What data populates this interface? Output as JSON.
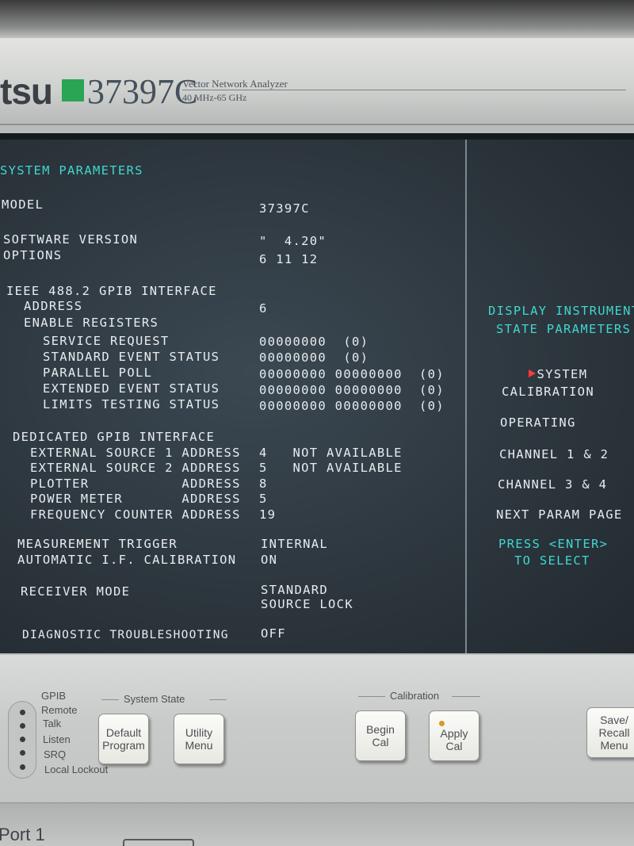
{
  "bezel": {
    "brand_fragment": "tsu",
    "model_number": "37397C",
    "product_name": "Vector Network Analyzer",
    "frequency_range": "40 MHz-65 GHz"
  },
  "screen": {
    "title": "SYSTEM PARAMETERS",
    "model_label": "MODEL",
    "model_value": "37397C",
    "software_version_label": "SOFTWARE VERSION",
    "software_version_value": "\"  4.20\"",
    "options_label": "OPTIONS",
    "options_value": "6 11 12",
    "ieee_label": "IEEE 488.2 GPIB INTERFACE",
    "address_label": "ADDRESS",
    "address_value": "6",
    "enable_registers_label": "ENABLE REGISTERS",
    "registers": [
      {
        "label": "SERVICE REQUEST",
        "value": "00000000  (0)"
      },
      {
        "label": "STANDARD EVENT STATUS",
        "value": "00000000  (0)"
      },
      {
        "label": "PARALLEL POLL",
        "value": "00000000 00000000  (0)"
      },
      {
        "label": "EXTENDED EVENT STATUS",
        "value": "00000000 00000000  (0)"
      },
      {
        "label": "LIMITS TESTING STATUS",
        "value": "00000000 00000000  (0)"
      }
    ],
    "dedicated_label": "DEDICATED GPIB INTERFACE",
    "dedicated": [
      {
        "label": "EXTERNAL SOURCE 1 ADDRESS",
        "value": "4   NOT AVAILABLE"
      },
      {
        "label": "EXTERNAL SOURCE 2 ADDRESS",
        "value": "5   NOT AVAILABLE"
      },
      {
        "label": "PLOTTER           ADDRESS",
        "value": "8"
      },
      {
        "label": "POWER METER       ADDRESS",
        "value": "5"
      },
      {
        "label": "FREQUENCY COUNTER ADDRESS",
        "value": "19"
      }
    ],
    "measurement_trigger_label": "MEASUREMENT TRIGGER",
    "measurement_trigger_value": "INTERNAL",
    "auto_if_cal_label": "AUTOMATIC I.F. CALIBRATION",
    "auto_if_cal_value": "ON",
    "receiver_mode_label": "RECEIVER MODE",
    "receiver_mode_value_1": "STANDARD",
    "receiver_mode_value_2": "SOURCE LOCK",
    "diagnostic_label": "DIAGNOSTIC TROUBLESHOOTING",
    "diagnostic_value": "OFF"
  },
  "softkeys": {
    "heading_1": "DISPLAY INSTRUMENT",
    "heading_2": "STATE PARAMETERS",
    "items": [
      "SYSTEM",
      "CALIBRATION",
      "OPERATING",
      "CHANNEL 1 & 2",
      "CHANNEL 3 & 4",
      "NEXT PARAM PAGE"
    ],
    "prompt_1": "PRESS <ENTER>",
    "prompt_2": "TO SELECT",
    "selected_index": 0
  },
  "panel": {
    "gpib_status": [
      "GPIB",
      "Remote",
      "Talk",
      "Listen",
      "SRQ",
      "Local Lockout"
    ],
    "system_state_label": "System State",
    "calibration_label": "Calibration",
    "buttons": {
      "default_program": "Default\nProgram",
      "utility_menu": "Utility\nMenu",
      "begin_cal": "Begin\nCal",
      "apply_cal": "Apply\nCal",
      "save_recall": "Save/\nRecall\nMenu"
    },
    "port_label": "Port 1"
  },
  "colors": {
    "screen_text": "#e7ecef",
    "screen_heading": "#3fd6d0",
    "selection_arrow": "#ff3a3a",
    "brand_green": "#2aa553"
  }
}
